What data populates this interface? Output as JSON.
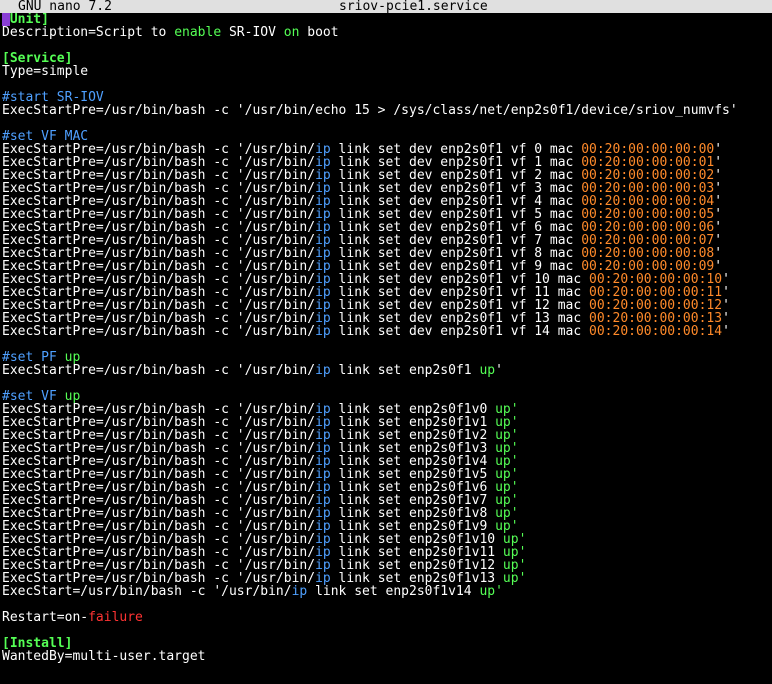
{
  "window": {
    "app_name": "GNU nano 7.2",
    "file_name": "sriov-pcie1.service"
  },
  "colors": {
    "title_bg": "#e0e0e0",
    "background": "#000000",
    "text": "#ffffff",
    "section": "#55ff55",
    "comment": "#4fa0ff",
    "keyword_ip": "#4fa0ff",
    "mac_address": "#ff8a2a",
    "failure": "#ff3333",
    "cursor": "#8a3fd6"
  },
  "lines": [
    [
      {
        "text": "[Unit]",
        "style": "section",
        "cursor": true
      }
    ],
    [
      {
        "text": "Description=Script to ",
        "style": "default"
      },
      {
        "text": "enable",
        "style": "green"
      },
      {
        "text": " SR-IOV ",
        "style": "default"
      },
      {
        "text": "on",
        "style": "green"
      },
      {
        "text": " boot",
        "style": "default"
      }
    ],
    [],
    [
      {
        "text": "[Service]",
        "style": "section"
      }
    ],
    [
      {
        "text": "Type=simple",
        "style": "default"
      }
    ],
    [],
    [
      {
        "text": "#start SR-IOV",
        "style": "comment"
      }
    ],
    [
      {
        "text": "ExecStartPre=/usr/bin/bash -c '/usr/bin/echo 15 > /sys/class/net/enp2s0f1/device/sriov_numvfs'",
        "style": "default"
      }
    ],
    [],
    [
      {
        "text": "#set VF MAC",
        "style": "comment"
      }
    ],
    [
      {
        "text": "ExecStartPre=/usr/bin/bash -c '/usr/bin/",
        "style": "default"
      },
      {
        "text": "ip",
        "style": "blue"
      },
      {
        "text": " link set dev enp2s0f1 vf 0 mac ",
        "style": "default"
      },
      {
        "text": "00:20:00:00:00:00",
        "style": "orange"
      },
      {
        "text": "'",
        "style": "default"
      }
    ],
    [
      {
        "text": "ExecStartPre=/usr/bin/bash -c '/usr/bin/",
        "style": "default"
      },
      {
        "text": "ip",
        "style": "blue"
      },
      {
        "text": " link set dev enp2s0f1 vf 1 mac ",
        "style": "default"
      },
      {
        "text": "00:20:00:00:00:01",
        "style": "orange"
      },
      {
        "text": "'",
        "style": "default"
      }
    ],
    [
      {
        "text": "ExecStartPre=/usr/bin/bash -c '/usr/bin/",
        "style": "default"
      },
      {
        "text": "ip",
        "style": "blue"
      },
      {
        "text": " link set dev enp2s0f1 vf 2 mac ",
        "style": "default"
      },
      {
        "text": "00:20:00:00:00:02",
        "style": "orange"
      },
      {
        "text": "'",
        "style": "default"
      }
    ],
    [
      {
        "text": "ExecStartPre=/usr/bin/bash -c '/usr/bin/",
        "style": "default"
      },
      {
        "text": "ip",
        "style": "blue"
      },
      {
        "text": " link set dev enp2s0f1 vf 3 mac ",
        "style": "default"
      },
      {
        "text": "00:20:00:00:00:03",
        "style": "orange"
      },
      {
        "text": "'",
        "style": "default"
      }
    ],
    [
      {
        "text": "ExecStartPre=/usr/bin/bash -c '/usr/bin/",
        "style": "default"
      },
      {
        "text": "ip",
        "style": "blue"
      },
      {
        "text": " link set dev enp2s0f1 vf 4 mac ",
        "style": "default"
      },
      {
        "text": "00:20:00:00:00:04",
        "style": "orange"
      },
      {
        "text": "'",
        "style": "default"
      }
    ],
    [
      {
        "text": "ExecStartPre=/usr/bin/bash -c '/usr/bin/",
        "style": "default"
      },
      {
        "text": "ip",
        "style": "blue"
      },
      {
        "text": " link set dev enp2s0f1 vf 5 mac ",
        "style": "default"
      },
      {
        "text": "00:20:00:00:00:05",
        "style": "orange"
      },
      {
        "text": "'",
        "style": "default"
      }
    ],
    [
      {
        "text": "ExecStartPre=/usr/bin/bash -c '/usr/bin/",
        "style": "default"
      },
      {
        "text": "ip",
        "style": "blue"
      },
      {
        "text": " link set dev enp2s0f1 vf 6 mac ",
        "style": "default"
      },
      {
        "text": "00:20:00:00:00:06",
        "style": "orange"
      },
      {
        "text": "'",
        "style": "default"
      }
    ],
    [
      {
        "text": "ExecStartPre=/usr/bin/bash -c '/usr/bin/",
        "style": "default"
      },
      {
        "text": "ip",
        "style": "blue"
      },
      {
        "text": " link set dev enp2s0f1 vf 7 mac ",
        "style": "default"
      },
      {
        "text": "00:20:00:00:00:07",
        "style": "orange"
      },
      {
        "text": "'",
        "style": "default"
      }
    ],
    [
      {
        "text": "ExecStartPre=/usr/bin/bash -c '/usr/bin/",
        "style": "default"
      },
      {
        "text": "ip",
        "style": "blue"
      },
      {
        "text": " link set dev enp2s0f1 vf 8 mac ",
        "style": "default"
      },
      {
        "text": "00:20:00:00:00:08",
        "style": "orange"
      },
      {
        "text": "'",
        "style": "default"
      }
    ],
    [
      {
        "text": "ExecStartPre=/usr/bin/bash -c '/usr/bin/",
        "style": "default"
      },
      {
        "text": "ip",
        "style": "blue"
      },
      {
        "text": " link set dev enp2s0f1 vf 9 mac ",
        "style": "default"
      },
      {
        "text": "00:20:00:00:00:09",
        "style": "orange"
      },
      {
        "text": "'",
        "style": "default"
      }
    ],
    [
      {
        "text": "ExecStartPre=/usr/bin/bash -c '/usr/bin/",
        "style": "default"
      },
      {
        "text": "ip",
        "style": "blue"
      },
      {
        "text": " link set dev enp2s0f1 vf 10 mac ",
        "style": "default"
      },
      {
        "text": "00:20:00:00:00:10",
        "style": "orange"
      },
      {
        "text": "'",
        "style": "default"
      }
    ],
    [
      {
        "text": "ExecStartPre=/usr/bin/bash -c '/usr/bin/",
        "style": "default"
      },
      {
        "text": "ip",
        "style": "blue"
      },
      {
        "text": " link set dev enp2s0f1 vf 11 mac ",
        "style": "default"
      },
      {
        "text": "00:20:00:00:00:11",
        "style": "orange"
      },
      {
        "text": "'",
        "style": "default"
      }
    ],
    [
      {
        "text": "ExecStartPre=/usr/bin/bash -c '/usr/bin/",
        "style": "default"
      },
      {
        "text": "ip",
        "style": "blue"
      },
      {
        "text": " link set dev enp2s0f1 vf 12 mac ",
        "style": "default"
      },
      {
        "text": "00:20:00:00:00:12",
        "style": "orange"
      },
      {
        "text": "'",
        "style": "default"
      }
    ],
    [
      {
        "text": "ExecStartPre=/usr/bin/bash -c '/usr/bin/",
        "style": "default"
      },
      {
        "text": "ip",
        "style": "blue"
      },
      {
        "text": " link set dev enp2s0f1 vf 13 mac ",
        "style": "default"
      },
      {
        "text": "00:20:00:00:00:13",
        "style": "orange"
      },
      {
        "text": "'",
        "style": "default"
      }
    ],
    [
      {
        "text": "ExecStartPre=/usr/bin/bash -c '/usr/bin/",
        "style": "default"
      },
      {
        "text": "ip",
        "style": "blue"
      },
      {
        "text": " link set dev enp2s0f1 vf 14 mac ",
        "style": "default"
      },
      {
        "text": "00:20:00:00:00:14",
        "style": "orange"
      },
      {
        "text": "'",
        "style": "default"
      }
    ],
    [],
    [
      {
        "text": "#set PF ",
        "style": "comment"
      },
      {
        "text": "up",
        "style": "green"
      }
    ],
    [
      {
        "text": "ExecStartPre=/usr/bin/bash -c '/usr/bin/",
        "style": "default"
      },
      {
        "text": "ip",
        "style": "blue"
      },
      {
        "text": " link set enp2s0f1 ",
        "style": "default"
      },
      {
        "text": "up",
        "style": "green"
      },
      {
        "text": "'",
        "style": "default"
      }
    ],
    [],
    [
      {
        "text": "#set VF ",
        "style": "comment"
      },
      {
        "text": "up",
        "style": "green"
      }
    ],
    [
      {
        "text": "ExecStartPre=/usr/bin/bash -c '/usr/bin/",
        "style": "default"
      },
      {
        "text": "ip",
        "style": "blue"
      },
      {
        "text": " link set enp2s0f1v0 ",
        "style": "default"
      },
      {
        "text": "up",
        "style": "green"
      },
      {
        "text": "'",
        "style": "green"
      }
    ],
    [
      {
        "text": "ExecStartPre=/usr/bin/bash -c '/usr/bin/",
        "style": "default"
      },
      {
        "text": "ip",
        "style": "blue"
      },
      {
        "text": " link set enp2s0f1v1 ",
        "style": "default"
      },
      {
        "text": "up",
        "style": "green"
      },
      {
        "text": "'",
        "style": "green"
      }
    ],
    [
      {
        "text": "ExecStartPre=/usr/bin/bash -c '/usr/bin/",
        "style": "default"
      },
      {
        "text": "ip",
        "style": "blue"
      },
      {
        "text": " link set enp2s0f1v2 ",
        "style": "default"
      },
      {
        "text": "up",
        "style": "green"
      },
      {
        "text": "'",
        "style": "green"
      }
    ],
    [
      {
        "text": "ExecStartPre=/usr/bin/bash -c '/usr/bin/",
        "style": "default"
      },
      {
        "text": "ip",
        "style": "blue"
      },
      {
        "text": " link set enp2s0f1v3 ",
        "style": "default"
      },
      {
        "text": "up",
        "style": "green"
      },
      {
        "text": "'",
        "style": "green"
      }
    ],
    [
      {
        "text": "ExecStartPre=/usr/bin/bash -c '/usr/bin/",
        "style": "default"
      },
      {
        "text": "ip",
        "style": "blue"
      },
      {
        "text": " link set enp2s0f1v4 ",
        "style": "default"
      },
      {
        "text": "up",
        "style": "green"
      },
      {
        "text": "'",
        "style": "green"
      }
    ],
    [
      {
        "text": "ExecStartPre=/usr/bin/bash -c '/usr/bin/",
        "style": "default"
      },
      {
        "text": "ip",
        "style": "blue"
      },
      {
        "text": " link set enp2s0f1v5 ",
        "style": "default"
      },
      {
        "text": "up",
        "style": "green"
      },
      {
        "text": "'",
        "style": "green"
      }
    ],
    [
      {
        "text": "ExecStartPre=/usr/bin/bash -c '/usr/bin/",
        "style": "default"
      },
      {
        "text": "ip",
        "style": "blue"
      },
      {
        "text": " link set enp2s0f1v6 ",
        "style": "default"
      },
      {
        "text": "up",
        "style": "green"
      },
      {
        "text": "'",
        "style": "green"
      }
    ],
    [
      {
        "text": "ExecStartPre=/usr/bin/bash -c '/usr/bin/",
        "style": "default"
      },
      {
        "text": "ip",
        "style": "blue"
      },
      {
        "text": " link set enp2s0f1v7 ",
        "style": "default"
      },
      {
        "text": "up",
        "style": "green"
      },
      {
        "text": "'",
        "style": "green"
      }
    ],
    [
      {
        "text": "ExecStartPre=/usr/bin/bash -c '/usr/bin/",
        "style": "default"
      },
      {
        "text": "ip",
        "style": "blue"
      },
      {
        "text": " link set enp2s0f1v8 ",
        "style": "default"
      },
      {
        "text": "up",
        "style": "green"
      },
      {
        "text": "'",
        "style": "green"
      }
    ],
    [
      {
        "text": "ExecStartPre=/usr/bin/bash -c '/usr/bin/",
        "style": "default"
      },
      {
        "text": "ip",
        "style": "blue"
      },
      {
        "text": " link set enp2s0f1v9 ",
        "style": "default"
      },
      {
        "text": "up",
        "style": "green"
      },
      {
        "text": "'",
        "style": "green"
      }
    ],
    [
      {
        "text": "ExecStartPre=/usr/bin/bash -c '/usr/bin/",
        "style": "default"
      },
      {
        "text": "ip",
        "style": "blue"
      },
      {
        "text": " link set enp2s0f1v10 ",
        "style": "default"
      },
      {
        "text": "up",
        "style": "green"
      },
      {
        "text": "'",
        "style": "green"
      }
    ],
    [
      {
        "text": "ExecStartPre=/usr/bin/bash -c '/usr/bin/",
        "style": "default"
      },
      {
        "text": "ip",
        "style": "blue"
      },
      {
        "text": " link set enp2s0f1v11 ",
        "style": "default"
      },
      {
        "text": "up",
        "style": "green"
      },
      {
        "text": "'",
        "style": "green"
      }
    ],
    [
      {
        "text": "ExecStartPre=/usr/bin/bash -c '/usr/bin/",
        "style": "default"
      },
      {
        "text": "ip",
        "style": "blue"
      },
      {
        "text": " link set enp2s0f1v12 ",
        "style": "default"
      },
      {
        "text": "up",
        "style": "green"
      },
      {
        "text": "'",
        "style": "green"
      }
    ],
    [
      {
        "text": "ExecStartPre=/usr/bin/bash -c '/usr/bin/",
        "style": "default"
      },
      {
        "text": "ip",
        "style": "blue"
      },
      {
        "text": " link set enp2s0f1v13 ",
        "style": "default"
      },
      {
        "text": "up",
        "style": "green"
      },
      {
        "text": "'",
        "style": "green"
      }
    ],
    [
      {
        "text": "ExecStart=/usr/bin/bash -c '/usr/bin/",
        "style": "default"
      },
      {
        "text": "ip",
        "style": "blue"
      },
      {
        "text": " link set enp2s0f1v14 ",
        "style": "default"
      },
      {
        "text": "up",
        "style": "green"
      },
      {
        "text": "'",
        "style": "green"
      }
    ],
    [],
    [
      {
        "text": "Restart=on-",
        "style": "default"
      },
      {
        "text": "failure",
        "style": "red"
      }
    ],
    [],
    [
      {
        "text": "[Install]",
        "style": "section"
      }
    ],
    [
      {
        "text": "WantedBy=multi-user.target",
        "style": "default"
      }
    ]
  ]
}
